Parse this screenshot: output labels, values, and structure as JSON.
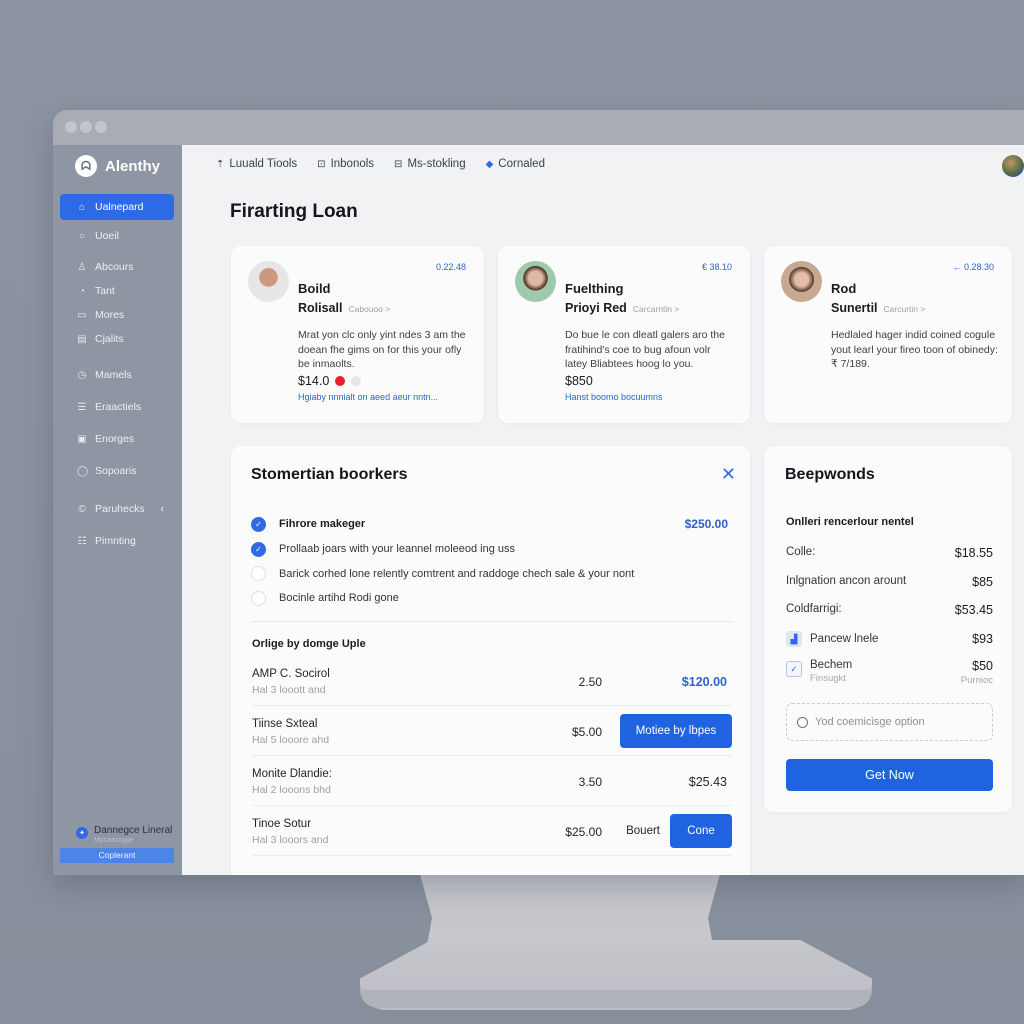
{
  "app": {
    "name": "Alenthy"
  },
  "sidebar": {
    "items": [
      {
        "label": "Ualnepard",
        "icon": "home-icon",
        "active": true
      },
      {
        "label": "Uoeil",
        "icon": "circle-icon",
        "active": false
      },
      {
        "label": "Abcours",
        "icon": "user-icon",
        "active": false
      },
      {
        "label": "Tant",
        "icon": "tag-icon",
        "active": false
      },
      {
        "label": "Mores",
        "icon": "folder-icon",
        "active": false
      },
      {
        "label": "Cjalits",
        "icon": "document-icon",
        "active": false
      },
      {
        "label": "Mamels",
        "icon": "clock-icon",
        "active": false
      },
      {
        "label": "Eraactiels",
        "icon": "list-icon",
        "active": false
      },
      {
        "label": "Enorges",
        "icon": "image-icon",
        "active": false
      },
      {
        "label": "Sopoaris",
        "icon": "chat-icon",
        "active": false
      },
      {
        "label": "Paruhecks",
        "icon": "copyright-icon",
        "active": false,
        "has_chevron": true
      },
      {
        "label": "Pimnting",
        "icon": "people-icon",
        "active": false
      }
    ],
    "footer": {
      "title": "Dannegce Lineral",
      "subtitle": "Mpcaaxxgge",
      "button_label": "Coplerant"
    }
  },
  "topnav": {
    "items": [
      {
        "label": "Luuald Tiools",
        "icon": "pin-icon"
      },
      {
        "label": "Inbonols",
        "icon": "inbox-icon"
      },
      {
        "label": "Ms-stokling",
        "icon": "stack-icon"
      },
      {
        "label": "Cornaled",
        "icon": "diamond-icon"
      }
    ]
  },
  "page": {
    "title": "Firarting Loan"
  },
  "profiles": [
    {
      "name": "Boild",
      "role": "Rolisall",
      "meta": "Cabouoo >",
      "amount": "0.22.48",
      "description": "Mrat yon clc only yint ndes 3 am the doean fhe gims on for this your ofly be inmaolts.",
      "price": "$14.0",
      "swatches": [
        "#e8202a",
        "#e6e7ea"
      ],
      "link": "Hgiaby nnnialt on aeed aeur nntn..."
    },
    {
      "name": "Fuelthing",
      "role": "Prioyi Red",
      "meta": "Carcarntin >",
      "amount": "€ 38.10",
      "description": "Do bue le con dleatl galers aro the fratihind's coe to bug afoun volr latey Bliabtees hoog lo you.",
      "price": "$850",
      "swatches": [],
      "link": "Hanst boomo bocuumns"
    },
    {
      "name": "Rod",
      "role": "Sunertil",
      "meta": "Carcurtin >",
      "amount": "← 0.28.30",
      "description": "Hedlaled hager indid coined cogule yout learl your fireo toon of obinedy: ₹ 7/189.",
      "price": "",
      "swatches": [],
      "link": ""
    }
  ],
  "checklist_panel": {
    "title": "Stomertian boorkers",
    "items": [
      {
        "label": "Fihrore makeger",
        "checked": true,
        "bold": true,
        "amount": "$250.00"
      },
      {
        "label": "Prollaab joars with your leannel moleeod ing uss",
        "checked": true,
        "bold": false,
        "amount": ""
      },
      {
        "label": "Barick corhed lone relently comtrent and raddoge chech sale & your nont",
        "checked": false,
        "bold": false,
        "amount": ""
      },
      {
        "label": "Bocinle artihd Rodi gone",
        "checked": false,
        "bold": false,
        "amount": ""
      }
    ],
    "section_label": "Orlige by domge Uple",
    "rows": [
      {
        "name": "AMP C. Socirol",
        "sub": "Hal 3 looott and",
        "qty": "2.50",
        "total": "$120.00",
        "action": ""
      },
      {
        "name": "Tiinse Sxteal",
        "sub": "Hal 5 looore ahd",
        "qty": "$5.00",
        "total": "",
        "action": "Motiee by lbpes"
      },
      {
        "name": "Monite Dlandie:",
        "sub": "Hal 2 looons bhd",
        "qty": "3.50",
        "total": "$25.43",
        "action": ""
      },
      {
        "name": "Tinoe Sotur",
        "sub": "Hal 3 looors and",
        "qty": "$25.00",
        "total": "",
        "text_action": "Bouert",
        "action": "Cone"
      }
    ]
  },
  "summary_panel": {
    "title": "Beepwonds",
    "subtitle": "Onlleri rencerlour nentel",
    "rows": [
      {
        "label": "Colle:",
        "value": "$18.55"
      },
      {
        "label": "Inlgnation ancon arount",
        "value": "$85"
      },
      {
        "label": "Coldfarrigi:",
        "value": "$53.45"
      }
    ],
    "extras": [
      {
        "label": "Pancew lnele",
        "value": "$93",
        "icon": "chart-icon",
        "sub": "",
        "sub_value": ""
      },
      {
        "label": "Bechem",
        "value": "$50",
        "icon": "checkbox-icon",
        "sub": "Finsugkt",
        "sub_value": "Purnioc",
        "checked": true
      }
    ],
    "option_label": "Yod coemicisge option",
    "cta_label": "Get Now"
  },
  "colors": {
    "accent": "#2f6ae6",
    "sidebar_bg": "#8e95a3",
    "main_bg": "#f1f2f4",
    "link_blue": "#2f62c9"
  }
}
